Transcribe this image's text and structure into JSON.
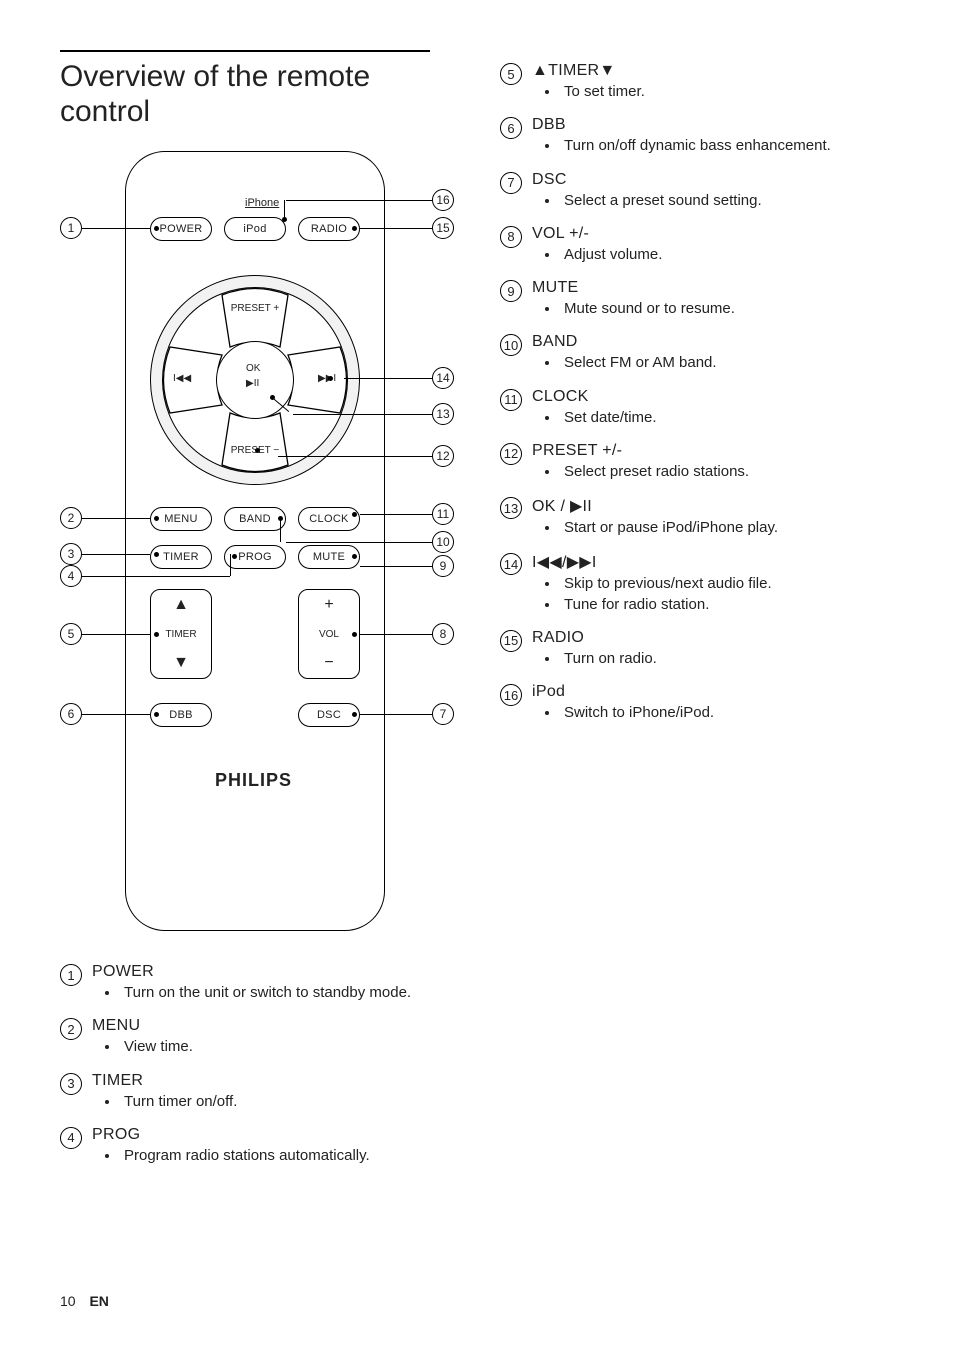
{
  "title": "Overview of the remote control",
  "page_number": "10",
  "lang": "EN",
  "diagram": {
    "iphone": "iPhone",
    "power": "POWER",
    "ipod": "iPod",
    "radio": "RADIO",
    "preset_plus": "PRESET +",
    "preset_minus": "PRESET −",
    "ok": "OK",
    "play_pause": "▶II",
    "prev": "I◀◀",
    "next": "▶▶I",
    "menu": "MENU",
    "band": "BAND",
    "clock": "CLOCK",
    "timer": "TIMER",
    "prog": "PROG",
    "mute": "MUTE",
    "timer_label": "TIMER",
    "vol_label": "VOL",
    "up": "▲",
    "down": "▼",
    "plus": "+",
    "minus": "−",
    "dbb": "DBB",
    "dsc": "DSC",
    "logo": "PHILIPS"
  },
  "callouts_left": [
    {
      "n": "1",
      "label": "POWER",
      "bullets": [
        "Turn on the unit or switch to standby mode."
      ]
    },
    {
      "n": "2",
      "label": "MENU",
      "bullets": [
        "View time."
      ]
    },
    {
      "n": "3",
      "label": "TIMER",
      "bullets": [
        "Turn timer on/off."
      ]
    },
    {
      "n": "4",
      "label": "PROG",
      "bullets": [
        "Program radio stations automatically."
      ]
    }
  ],
  "callouts_right": [
    {
      "n": "5",
      "label": "▲TIMER▼",
      "bullets": [
        "To set timer."
      ]
    },
    {
      "n": "6",
      "label": "DBB",
      "bullets": [
        "Turn on/off dynamic bass enhancement."
      ]
    },
    {
      "n": "7",
      "label": "DSC",
      "bullets": [
        "Select a preset sound setting."
      ]
    },
    {
      "n": "8",
      "label": "VOL +/-",
      "bullets": [
        "Adjust volume."
      ]
    },
    {
      "n": "9",
      "label": "MUTE",
      "bullets": [
        "Mute sound or to resume."
      ]
    },
    {
      "n": "10",
      "label": "BAND",
      "bullets": [
        "Select FM or AM band."
      ]
    },
    {
      "n": "11",
      "label": "CLOCK",
      "bullets": [
        "Set date/time."
      ]
    },
    {
      "n": "12",
      "label": "PRESET +/-",
      "bullets": [
        "Select preset radio stations."
      ]
    },
    {
      "n": "13",
      "label": "OK / ▶II",
      "bullets": [
        "Start or pause iPod/iPhone play."
      ]
    },
    {
      "n": "14",
      "label": "I◀◀/▶▶I",
      "bullets": [
        "Skip to previous/next audio file.",
        "Tune for radio station."
      ]
    },
    {
      "n": "15",
      "label": "RADIO",
      "bullets": [
        "Turn on radio."
      ]
    },
    {
      "n": "16",
      "label": "iPod",
      "bullets": [
        "Switch to iPhone/iPod."
      ]
    }
  ]
}
